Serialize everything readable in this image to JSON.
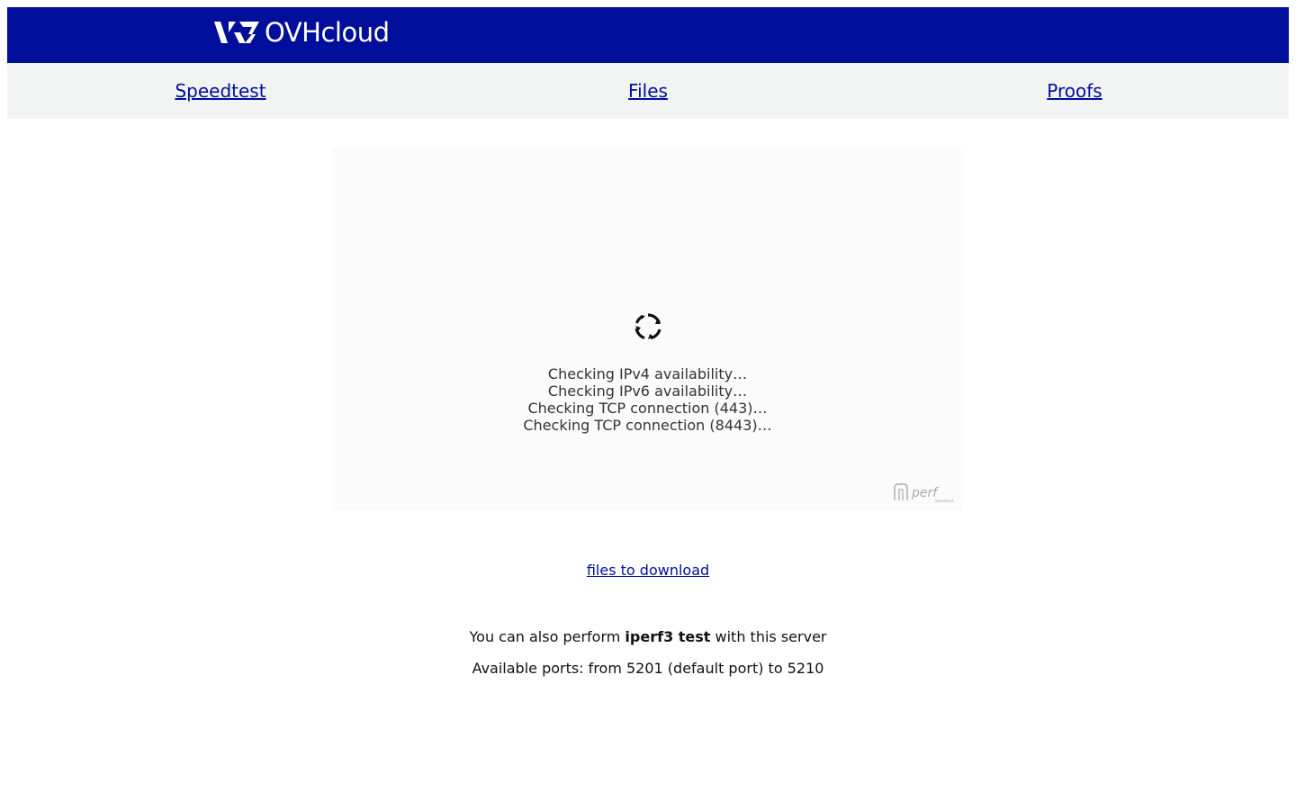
{
  "header": {
    "brand": "OVHcloud",
    "brand_color": "#000e9c"
  },
  "nav": {
    "items": [
      {
        "label": "Speedtest"
      },
      {
        "label": "Files"
      },
      {
        "label": "Proofs"
      }
    ]
  },
  "widget": {
    "spinner_icon": "loading-spinner-icon",
    "status": [
      "Checking IPv4 availability…",
      "Checking IPv6 availability…",
      "Checking TCP connection (443)…",
      "Checking TCP connection (8443)…"
    ],
    "watermark": "nperf"
  },
  "download": {
    "link_label": "files to download"
  },
  "iperf": {
    "prefix": "You can also perform ",
    "bold": "iperf3 test",
    "suffix": " with this server"
  },
  "ports": {
    "text": "Available ports: from 5201 (default port) to 5210"
  }
}
